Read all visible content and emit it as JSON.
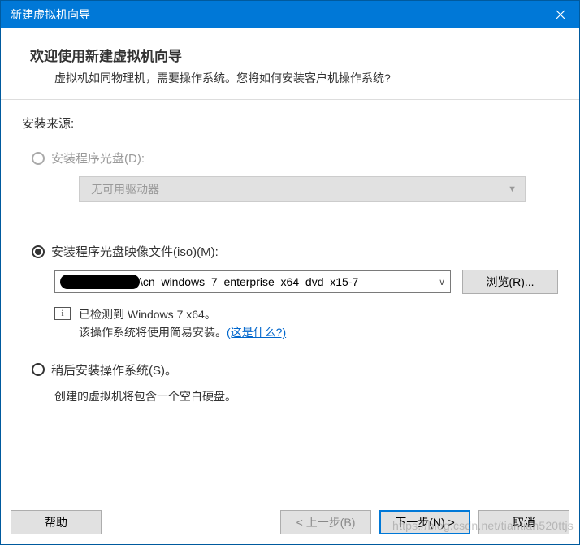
{
  "titlebar": {
    "title": "新建虚拟机向导"
  },
  "header": {
    "title": "欢迎使用新建虚拟机向导",
    "desc": "虚拟机如同物理机，需要操作系统。您将如何安装客户机操作系统?"
  },
  "section_label": "安装来源:",
  "option_disc": {
    "label": "安装程序光盘(D):"
  },
  "disc_dropdown": {
    "text": "无可用驱动器"
  },
  "option_iso": {
    "label": "安装程序光盘映像文件(iso)(M):"
  },
  "iso_combo": {
    "path": "\\cn_windows_7_enterprise_x64_dvd_x15-7"
  },
  "browse_label": "浏览(R)...",
  "info": {
    "line1_a": "已检测到 ",
    "line1_b": "Windows 7 x64",
    "line1_c": "。",
    "line2_a": "该操作系统将使用简易安装。",
    "link": "(这是什么?)"
  },
  "option_later": {
    "label": "稍后安装操作系统(S)。"
  },
  "later_desc": "创建的虚拟机将包含一个空白硬盘。",
  "footer": {
    "help": "帮助",
    "back": "< 上一步(B)",
    "next": "下一步(N) >",
    "cancel": "取消"
  },
  "watermark": "https://blog.csdn.net/tiantian520ttjs"
}
